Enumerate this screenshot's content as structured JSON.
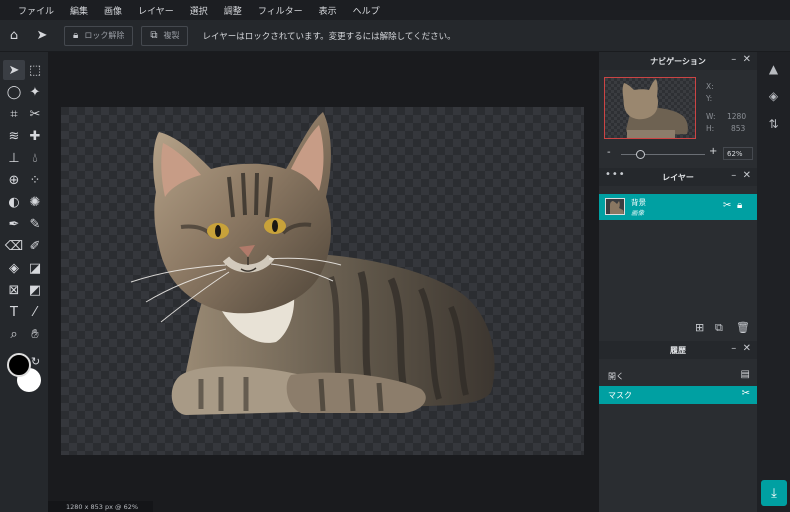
{
  "menu": [
    "ファイル",
    "編集",
    "画像",
    "レイヤー",
    "選択",
    "調整",
    "フィルター",
    "表示",
    "ヘルプ"
  ],
  "options": {
    "unlock_label": "ロック解除",
    "duplicate_label": "複製",
    "message": "レイヤーはロックされています。変更するには解除してください。"
  },
  "status": "1280 x 853 px @ 62%",
  "navigator": {
    "title": "ナビゲーション",
    "x_label": "X:",
    "y_label": "Y:",
    "w_label": "W:",
    "h_label": "H:",
    "w_value": "1280",
    "h_value": "853",
    "zoom_percent": 62,
    "zoom_value": "62%",
    "zoom_minus": "-",
    "zoom_plus": "+"
  },
  "layers": {
    "title": "レイヤー",
    "items": [
      {
        "name": "背景",
        "type": "画像"
      }
    ]
  },
  "history": {
    "title": "履歴",
    "items": [
      {
        "label": "開く",
        "icon": "image-icon",
        "selected": false
      },
      {
        "label": "マスク",
        "icon": "scissors-icon",
        "selected": true
      }
    ]
  },
  "colors": {
    "accent": "#00a0a2",
    "foreground": "#000000",
    "background": "#ffffff"
  }
}
